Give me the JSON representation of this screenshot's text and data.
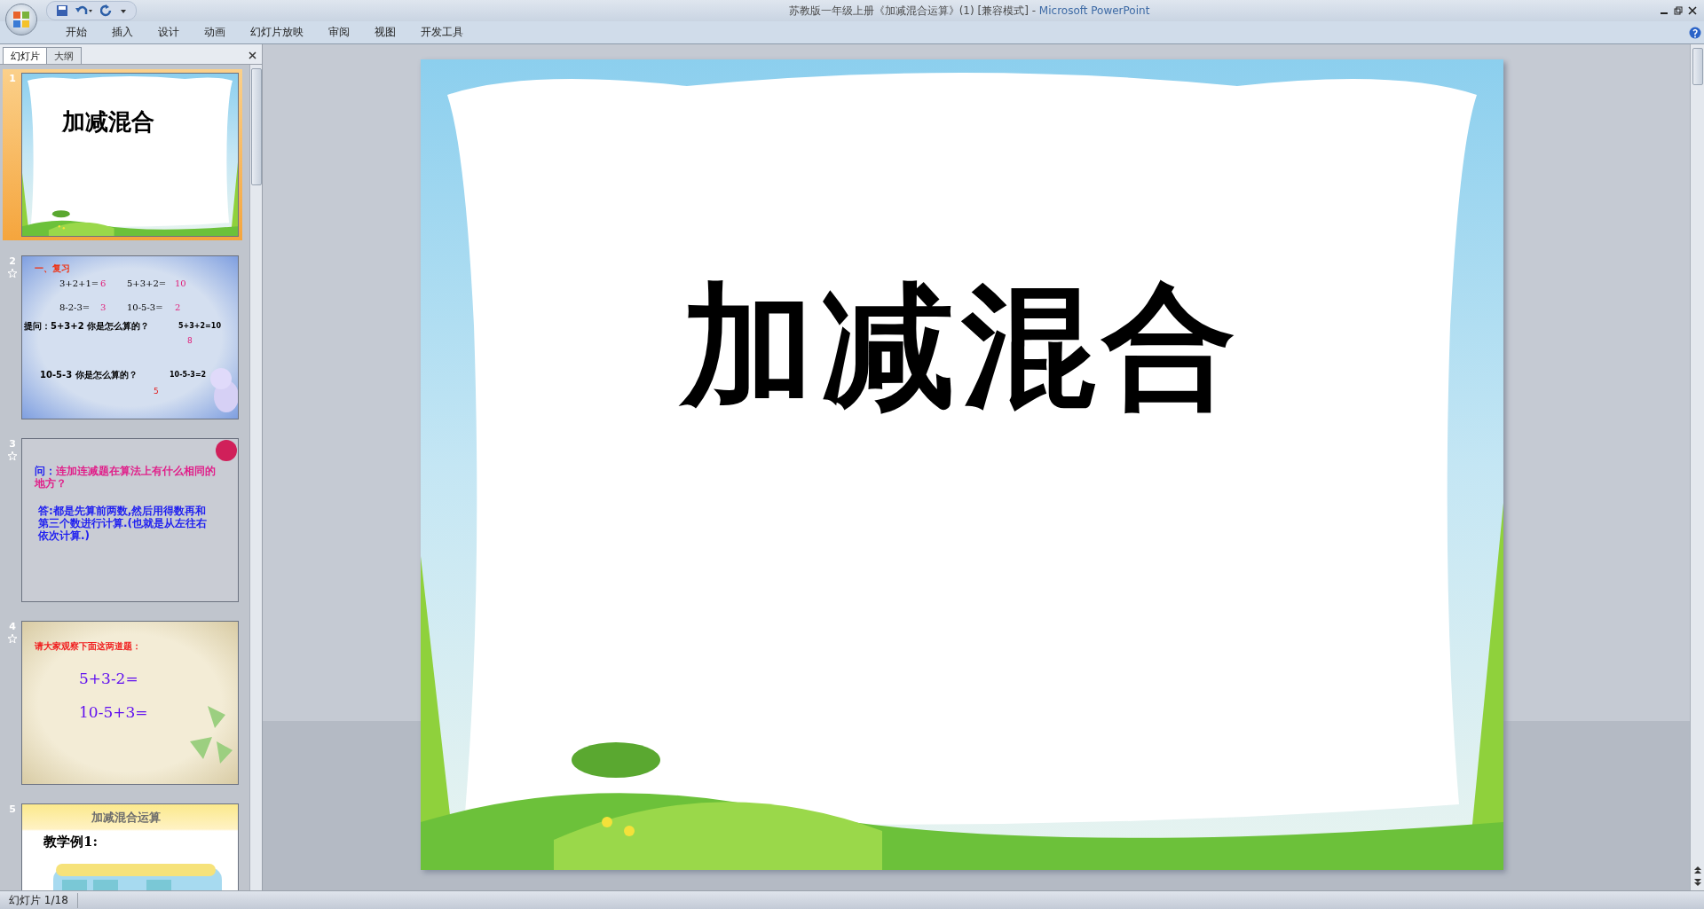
{
  "window": {
    "title": "苏教版一年级上册《加减混合运算》(1) [兼容模式]",
    "separator": "-",
    "app": "Microsoft PowerPoint"
  },
  "ribbon_tabs": [
    "开始",
    "插入",
    "设计",
    "动画",
    "幻灯片放映",
    "审阅",
    "视图",
    "开发工具"
  ],
  "panel_tabs": [
    {
      "label": "幻灯片",
      "selected": true
    },
    {
      "label": "大纲",
      "selected": false
    }
  ],
  "thumbnails": [
    {
      "number": "1",
      "selected": true,
      "animated": false,
      "kind": "title",
      "title": "加减混合"
    },
    {
      "number": "2",
      "selected": false,
      "animated": true,
      "kind": "review",
      "heading": "一、复习",
      "equations": [
        {
          "expr": "3+2+1=",
          "answer": "6"
        },
        {
          "expr": "5+3+2=",
          "answer": "10"
        },
        {
          "expr": "8-2-3=",
          "answer": "3"
        },
        {
          "expr": "10-5-3=",
          "answer": "2"
        }
      ],
      "question_1": "提问：5+3+2  你是怎么算的？",
      "work_1": "5+3+2=10",
      "partial_1": "8",
      "question_2": "10-5-3  你是怎么算的？",
      "work_2": "10-5-3=2",
      "partial_2": "5"
    },
    {
      "number": "3",
      "selected": false,
      "animated": true,
      "kind": "qa",
      "question_label": "问：",
      "question": "连加连减题在算法上有什么相同的地方？",
      "answer": "答:都是先算前两数,然后用得数再和第三个数进行计算.(也就是从左往右依次计算.)"
    },
    {
      "number": "4",
      "selected": false,
      "animated": true,
      "kind": "exercise",
      "heading": "请大家观察下面这两道题：",
      "lines": [
        "5+3-2=",
        "10-5+3="
      ]
    },
    {
      "number": "5",
      "selected": false,
      "animated": false,
      "kind": "example",
      "banner": "加减混合运算",
      "label": "教学例1:"
    }
  ],
  "slide": {
    "title": "加减混合"
  },
  "status_bar": {
    "slide_counter": "幻灯片 1/18"
  }
}
